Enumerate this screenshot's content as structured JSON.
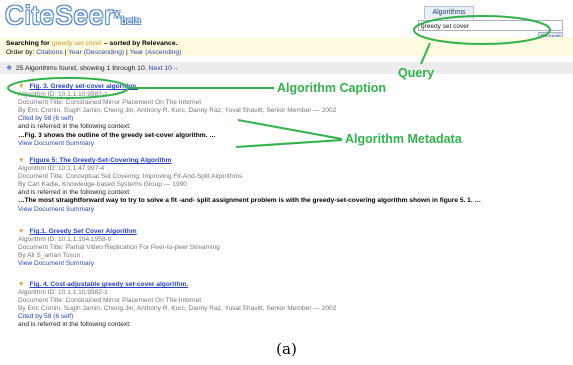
{
  "logo": {
    "name": "CiteSeer",
    "sup": "x",
    "beta": "beta"
  },
  "search": {
    "tab_label": "Algorithms",
    "query_value": "greedy set cover",
    "button_label": "Search"
  },
  "searching": {
    "prefix": "Searching for ",
    "query": "greedy set cover",
    "suffix": " – sorted by Relevance."
  },
  "order": {
    "prefix": "Order by: ",
    "links": [
      "Citations",
      "Year (Descending)",
      "Year (Ascending)"
    ],
    "separator": " | "
  },
  "results_info": {
    "text": "25 Algorithms found, showing 1 through 10. ",
    "next_link": "Next 10→"
  },
  "results": [
    {
      "title": "Fig. 3. Greedy set-cover algorithm.",
      "algorithm_id": "Algorithm ID: 10.1.1.10.9982-1",
      "document_title": "Document Title: Constrained Mirror Placement On The Internet",
      "authors": "By Eric Cronin, Sugih Jamin, Cheng Jin, Anthony R. Kurc, Danny Raz, Yuval Shavitt, Senior Member — 2002",
      "cited": "Cited by 58 (6 self)",
      "referred": "and is referred in the following context:",
      "context": "…Fig. 3 shows the outline of the greedy set-cover algorithm. …",
      "summary": "View Document Summary"
    },
    {
      "title": "Figure 5: The Greedy-Set-Covering Algorithm",
      "algorithm_id": "Algorithm ID: 10.1.1.47.997-4",
      "document_title": "Document Title: Conceptual Set Covering: Improving Fit-And-Split Algorithms",
      "authors": "By Carl Kadie, Knowledge-based Systems Group — 1990",
      "referred": "and is referred in the following context:",
      "context": "…The most straightforward way to try to solve a fit -and- split assignment problem is with the greedy-set-covering algorithm shown in figure 5. 1. …",
      "summary": "View Document Summary"
    },
    {
      "title": "Fig.1. Greedy Set Cover Algorithm",
      "algorithm_id": "Algorithm ID: 10.1.1.104.1958-0",
      "document_title": "Document Title: Partial Video Replication For Peer-to-peer Streaming",
      "authors": "By Ali S_aman Tosun",
      "summary": "View Document Summary"
    },
    {
      "title": "Fig. 4. Cost-adjustable greedy set-cover algorithm.",
      "algorithm_id": "Algorithm ID: 10.1.1.10.9982-1",
      "document_title": "Document Title: Constrained Mirror Placement On The Internet",
      "authors": "By Eric Cronin, Sugih Jamin, Cheng Jin, Anthony R. Kurc, Danny Raz, Yuval Shavitt, Senior Member — 2002",
      "cited": "Cited by 58 (6 self)",
      "referred": "and is referred in the following context:"
    }
  ],
  "annotations": {
    "query": "Query",
    "caption": "Algorithm Caption",
    "metadata": "Algorithm Metadata",
    "color": "#33b24b"
  },
  "figure_label": "(a)"
}
